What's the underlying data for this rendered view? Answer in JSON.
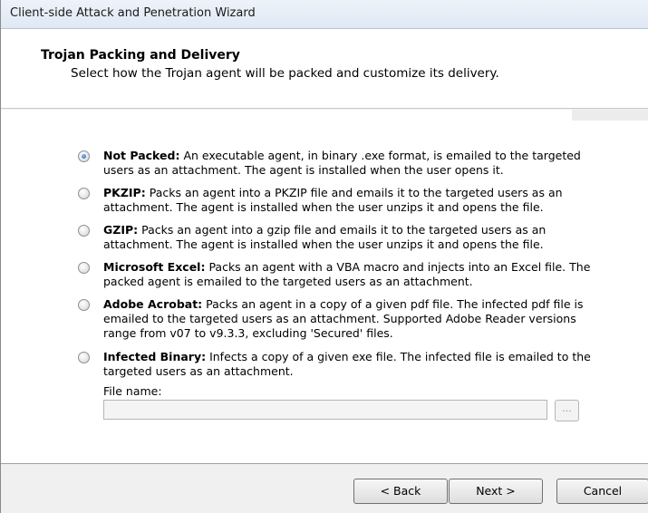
{
  "window": {
    "title": "Client-side Attack and Penetration Wizard"
  },
  "header": {
    "title": "Trojan Packing and Delivery",
    "description": "Select how the Trojan agent will be packed and customize its delivery."
  },
  "options": [
    {
      "name": "Not Packed:",
      "description": "An executable agent, in binary .exe format, is emailed to the targeted users as an attachment. The agent is installed when the user opens it.",
      "selected": true
    },
    {
      "name": "PKZIP:",
      "description": "Packs an agent into a PKZIP file and emails it to the targeted users as an attachment. The agent is installed when the user unzips it and opens the file.",
      "selected": false
    },
    {
      "name": "GZIP:",
      "description": "Packs an agent into a gzip file and emails it to the targeted users as an attachment. The agent is installed when the user unzips it and opens the file.",
      "selected": false
    },
    {
      "name": "Microsoft Excel:",
      "description": "Packs an agent with a VBA macro and injects into an Excel file. The packed agent is emailed to the targeted users as an attachment.",
      "selected": false
    },
    {
      "name": "Adobe Acrobat:",
      "description": "Packs an agent in a copy of a given pdf file. The infected pdf file is emailed to the targeted users as an attachment. Supported Adobe Reader versions range from v07 to v9.3.3, excluding 'Secured' files.",
      "selected": false
    },
    {
      "name": "Infected Binary:",
      "description": "Infects a copy of a given exe file. The infected file is emailed to the targeted users as an attachment.",
      "selected": false
    }
  ],
  "file": {
    "label": "File name:",
    "value": "",
    "browse_label": "..."
  },
  "buttons": {
    "back": "< Back",
    "next": "Next >",
    "cancel": "Cancel"
  }
}
